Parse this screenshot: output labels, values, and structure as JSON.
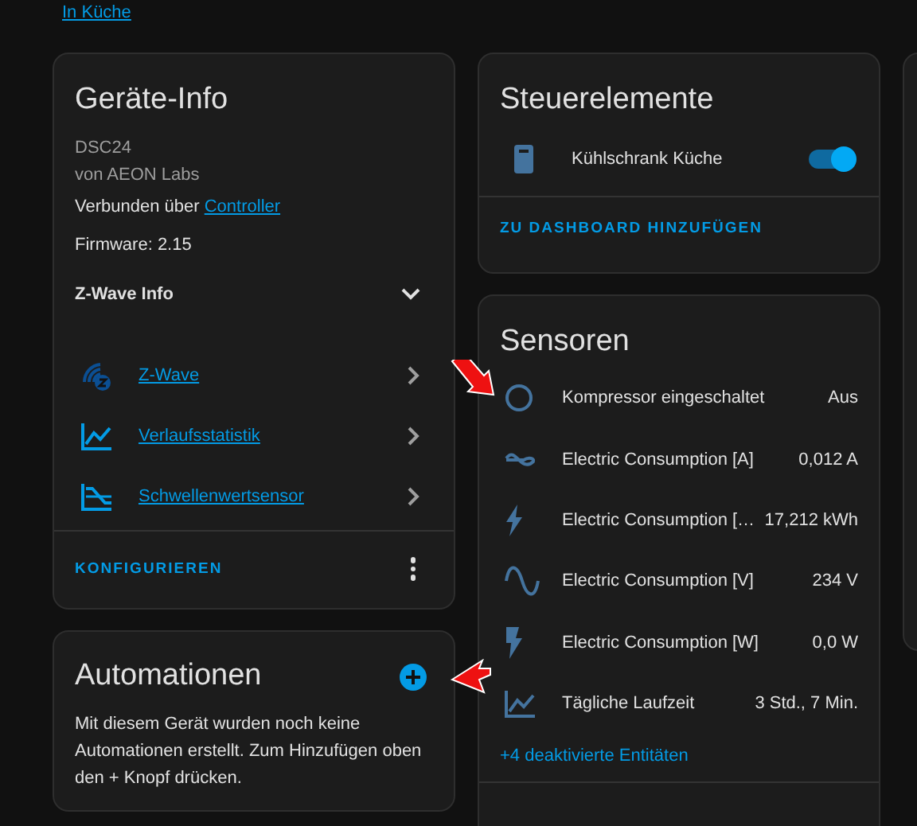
{
  "breadcrumb_link": "In Küche",
  "device_info": {
    "title": "Geräte-Info",
    "model": "DSC24",
    "manufacturer": "von AEON Labs",
    "connected_prefix": "Verbunden über",
    "connected_link": "Controller",
    "firmware": "Firmware: 2.15",
    "zwave_info": {
      "label": "Z-Wave Info",
      "expanded": false
    },
    "links": [
      {
        "kind": "zwave",
        "label": "Z-Wave"
      },
      {
        "kind": "history",
        "label": "Verlaufsstatistik"
      },
      {
        "kind": "threshold",
        "label": "Schwellenwertsensor"
      }
    ],
    "action": "KONFIGURIEREN"
  },
  "automations": {
    "title": "Automationen",
    "message": "Mit diesem Gerät wurden noch keine Automationen erstellt. Zum Hinzufügen oben den + Knopf drücken."
  },
  "controls": {
    "title": "Steuerelemente",
    "items": [
      {
        "label": "Kühlschrank Küche",
        "on": true
      }
    ],
    "action": "ZU DASHBOARD HINZUFÜGEN"
  },
  "sensors": {
    "title": "Sensoren",
    "items": [
      {
        "kind": "circle",
        "name": "Kompressor eingeschaltet",
        "value": "Aus"
      },
      {
        "kind": "current",
        "name": "Electric Consumption [A]",
        "value": "0,012 A"
      },
      {
        "kind": "bolt",
        "name": "Electric Consumption […",
        "value": "17,212 kWh"
      },
      {
        "kind": "sine",
        "name": "Electric Consumption [V]",
        "value": "234 V"
      },
      {
        "kind": "flash",
        "name": "Electric Consumption [W]",
        "value": "0,0 W"
      },
      {
        "kind": "chart",
        "name": "Tägliche Laufzeit",
        "value": "3 Std., 7 Min."
      }
    ],
    "more": "+4 deaktivierte Entitäten"
  }
}
